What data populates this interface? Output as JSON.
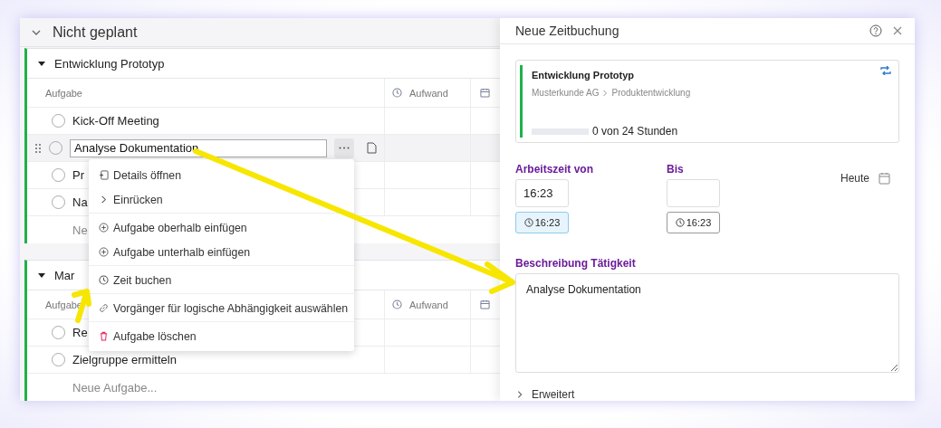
{
  "section": {
    "title": "Nicht geplant",
    "expanded": true
  },
  "groups": [
    {
      "title": "Entwicklung Prototyp",
      "expanded": true,
      "columns": [
        "Aufgabe",
        "Aufwand"
      ],
      "tasks": [
        {
          "name": "Kick-Off Meeting",
          "checked": false,
          "editing": false
        },
        {
          "name": "Analyse Dokumentation",
          "checked": false,
          "editing": true
        },
        {
          "name": "Pr",
          "checked": false,
          "editing": false
        },
        {
          "name": "Na",
          "checked": false,
          "editing": false
        }
      ],
      "new_task": "Ne"
    },
    {
      "title": "Mar",
      "expanded": true,
      "columns": [
        "Aufgabe",
        "Aufwand"
      ],
      "tasks": [
        {
          "name": "Re",
          "checked": false,
          "editing": false
        },
        {
          "name": "Zielgruppe ermitteln",
          "checked": false,
          "editing": false
        }
      ],
      "new_task": "Neue Aufgabe..."
    }
  ],
  "context_menu": {
    "groups": [
      [
        {
          "label": "Details öffnen",
          "kind": "normal"
        },
        {
          "label": "Einrücken",
          "kind": "normal"
        }
      ],
      [
        {
          "label": "Aufgabe oberhalb einfügen",
          "kind": "normal"
        },
        {
          "label": "Aufgabe unterhalb einfügen",
          "kind": "normal"
        }
      ],
      [
        {
          "label": "Zeit buchen",
          "kind": "normal"
        }
      ],
      [
        {
          "label": "Vorgänger für logische Abhängigkeit auswählen",
          "kind": "normal"
        }
      ],
      [
        {
          "label": "Aufgabe löschen",
          "kind": "danger"
        }
      ]
    ]
  },
  "panel": {
    "title": "Neue Zeitbuchung",
    "project": {
      "name": "Entwicklung Prototyp",
      "path": [
        "Musterkunde AG",
        "Produktentwicklung"
      ],
      "level": 0,
      "hours": "0 von 24 Stunden"
    },
    "time_fields": [
      {
        "label": "Arbeitszeit von",
        "value": "16:23",
        "button": "16:23",
        "selected": true
      },
      {
        "label": "Bis",
        "button": "16:23",
        "selected": false
      }
    ],
    "date": "Heute",
    "description": {
      "label": "Beschreibung Tätigkeit",
      "value": "Analyse Dokumentation"
    },
    "advanced": {
      "label": "Erweitert",
      "expanded": false
    }
  }
}
